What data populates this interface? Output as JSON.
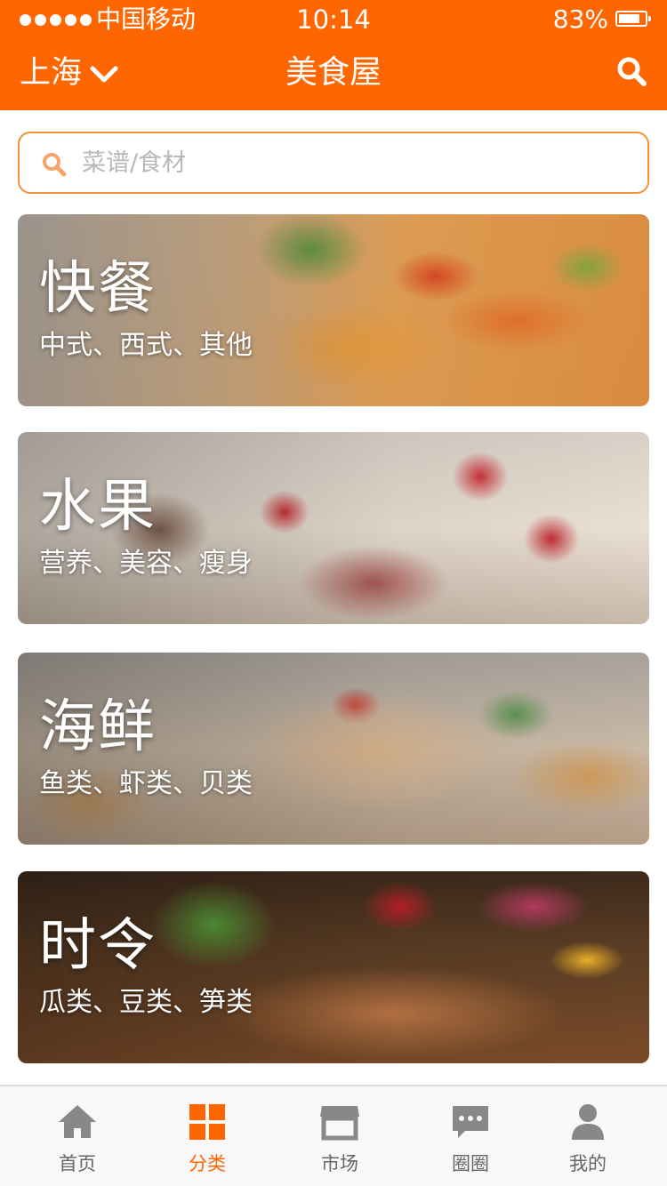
{
  "status_bar": {
    "carrier": "中国移动",
    "time": "10:14",
    "battery": "83%",
    "battery_level": 0.83,
    "signal_dots": 5
  },
  "nav": {
    "city": "上海",
    "title": "美食屋"
  },
  "search": {
    "placeholder": "菜谱/食材",
    "value": ""
  },
  "categories": [
    {
      "title": "快餐",
      "subtitle": "中式、西式、其他"
    },
    {
      "title": "水果",
      "subtitle": "营养、美容、瘦身"
    },
    {
      "title": "海鲜",
      "subtitle": "鱼类、虾类、贝类"
    },
    {
      "title": "时令",
      "subtitle": "瓜类、豆类、笋类"
    }
  ],
  "tabs": [
    {
      "label": "首页",
      "icon": "home-icon",
      "active": false
    },
    {
      "label": "分类",
      "icon": "grid-icon",
      "active": true
    },
    {
      "label": "市场",
      "icon": "store-icon",
      "active": false
    },
    {
      "label": "圈圈",
      "icon": "chat-icon",
      "active": false
    },
    {
      "label": "我的",
      "icon": "user-icon",
      "active": false
    }
  ],
  "colors": {
    "brand": "#ff6600",
    "search_border": "#f4923a",
    "tab_inactive": "#888888"
  }
}
